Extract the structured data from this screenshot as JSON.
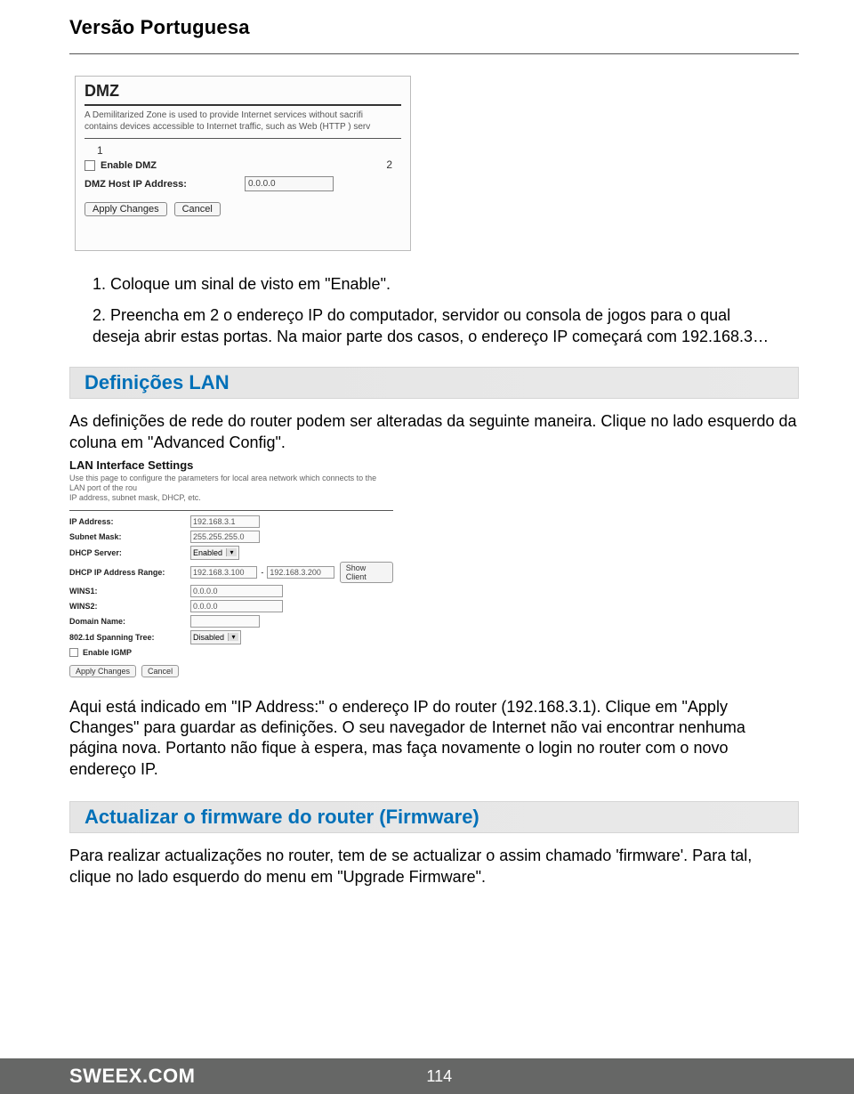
{
  "page": {
    "title": "Versão Portuguesa"
  },
  "dmz": {
    "panel_title": "DMZ",
    "description": "A Demilitarized Zone is used to provide Internet services without sacrifi\ncontains devices accessible to Internet traffic, such as Web (HTTP ) serv",
    "marker1": "1",
    "marker2": "2",
    "enable_label": "Enable DMZ",
    "host_label": "DMZ Host IP Address:",
    "host_value": "0.0.0.0",
    "apply_btn": "Apply Changes",
    "cancel_btn": "Cancel"
  },
  "steps": {
    "s1": "1. Coloque um sinal de visto em \"Enable\".",
    "s2": "2. Preencha em 2 o endereço IP do computador, servidor ou consola de jogos para o qual deseja abrir estas portas. Na maior parte dos casos, o endereço IP começará com 192.168.3…"
  },
  "lan_section": {
    "heading": "Definições LAN",
    "intro": "As definições de rede do router podem ser alteradas da seguinte maneira. Clique no lado esquerdo da coluna em \"Advanced Config\"."
  },
  "lan": {
    "panel_title": "LAN Interface Settings",
    "description": "Use this page to configure the parameters for local area network which connects to the LAN port of the rou\nIP address, subnet mask, DHCP, etc.",
    "labels": {
      "ip": "IP Address:",
      "subnet": "Subnet Mask:",
      "dhcp": "DHCP Server:",
      "range": "DHCP IP Address Range:",
      "wins1": "WINS1:",
      "wins2": "WINS2:",
      "domain": "Domain Name:",
      "spanning": "802.1d Spanning Tree:",
      "igmp": "Enable IGMP"
    },
    "values": {
      "ip": "192.168.3.1",
      "subnet": "255.255.255.0",
      "dhcp": "Enabled",
      "range_from": "192.168.3.100",
      "range_to": "192.168.3.200",
      "wins1": "0.0.0.0",
      "wins2": "0.0.0.0",
      "domain": "",
      "spanning": "Disabled"
    },
    "show_client_btn": "Show Client",
    "apply_btn": "Apply Changes",
    "cancel_btn": "Cancel"
  },
  "ip_para": "Aqui está indicado em \"IP Address:\" o endereço IP do router (192.168.3.1). Clique em \"Apply Changes\" para guardar as definições. O seu navegador de Internet não vai encontrar nenhuma página nova. Portanto não fique à espera, mas faça novamente o login no router com o novo endereço IP.",
  "fw_section": {
    "heading": "Actualizar o firmware do router (Firmware)",
    "text": "Para realizar actualizações no router, tem de se actualizar o assim chamado 'firmware'. Para tal, clique no lado esquerdo do menu em \"Upgrade Firmware\"."
  },
  "footer": {
    "logo": "SWEEX.COM",
    "page": "114"
  }
}
